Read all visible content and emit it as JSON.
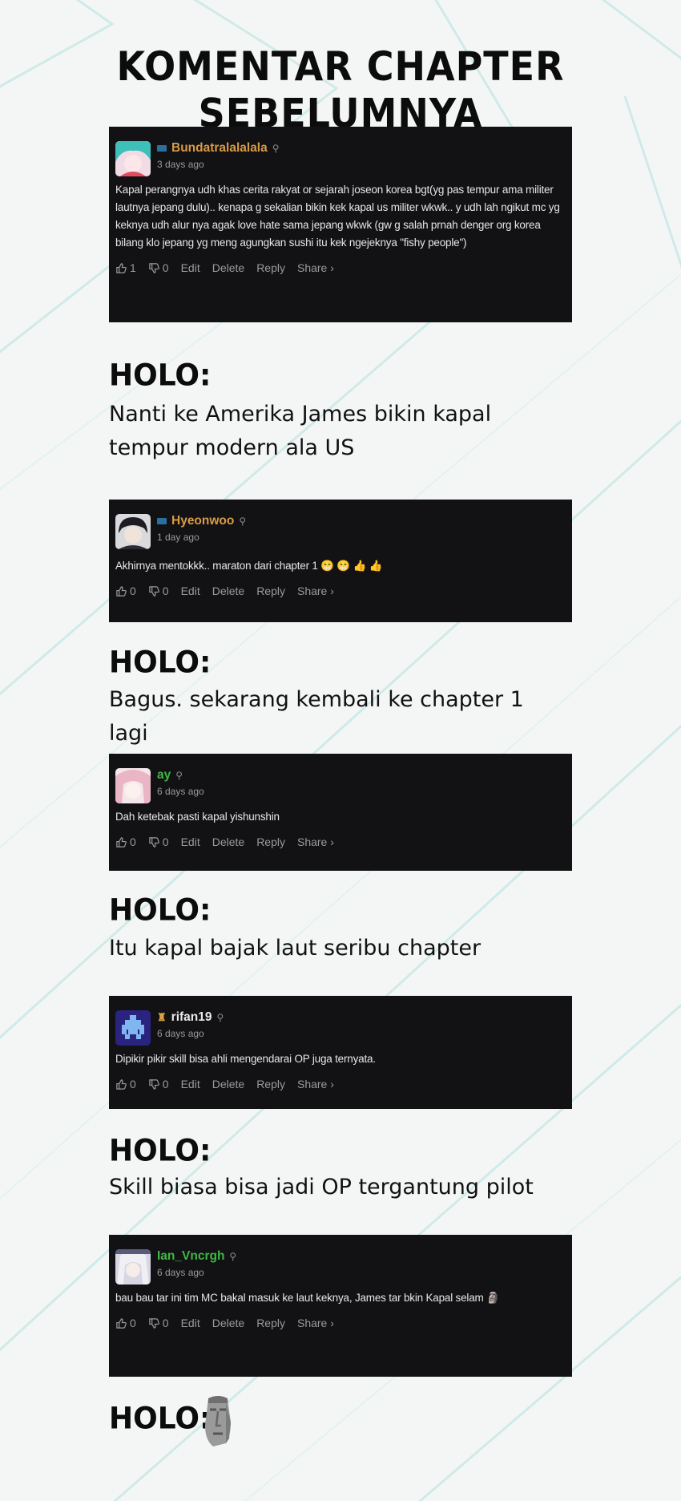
{
  "title": "KOMENTAR CHAPTER SEBELUMNYA",
  "comments": [
    {
      "username": "Bundatralalalala",
      "name_color": "#d99a44",
      "time": "3 days ago",
      "text": "Kapal perangnya udh khas cerita rakyat or sejarah joseon korea bgt(yg pas tempur ama militer lautnya jepang dulu).. kenapa g sekalian bikin kek kapal us militer wkwk.. y udh lah ngikut mc yg keknya udh alur nya agak love hate sama jepang wkwk (gw g salah prnah denger org korea bilang klo jepang yg meng agungkan sushi itu kek ngejeknya \"fishy people\")",
      "likes": "1",
      "dislikes": "0",
      "avatar": "anime-girl-teal-hair"
    },
    {
      "username": "Hyeonwoo",
      "name_color": "#d99a44",
      "time": "1 day ago",
      "text": "Akhirnya mentokkk.. maraton dari chapter 1 😁 😁 👍 👍",
      "likes": "0",
      "dislikes": "0",
      "avatar": "dark-haired-boy"
    },
    {
      "username": "ay",
      "name_color": "#3db843",
      "time": "6 days ago",
      "text": "Dah ketebak pasti kapal yishunshin",
      "likes": "0",
      "dislikes": "0",
      "avatar": "pink-haired-girl"
    },
    {
      "username": "rifan19",
      "name_color": "#e9e9e9",
      "time": "6 days ago",
      "text": "Dipikir pikir skill bisa ahli mengendarai OP juga ternyata.",
      "likes": "0",
      "dislikes": "0",
      "avatar": "pixel-invader"
    },
    {
      "username": "Ian_Vncrgh",
      "name_color": "#3db843",
      "time": "6 days ago",
      "text": "bau bau tar ini tim MC bakal masuk ke laut keknya, James tar bkin Kapal selam 🗿",
      "likes": "0",
      "dislikes": "0",
      "avatar": "white-haired-character"
    }
  ],
  "actions": {
    "edit": "Edit",
    "delete": "Delete",
    "reply": "Reply",
    "share": "Share ›"
  },
  "holo_label": "HOLO:",
  "holo_replies": [
    "Nanti ke Amerika James bikin kapal tempur modern ala US",
    "Bagus. sekarang kembali ke chapter 1 lagi",
    "Itu kapal bajak laut seribu chapter",
    "Skill biasa bisa jadi OP tergantung pilot"
  ],
  "final_reply_icon": "moai-icon"
}
